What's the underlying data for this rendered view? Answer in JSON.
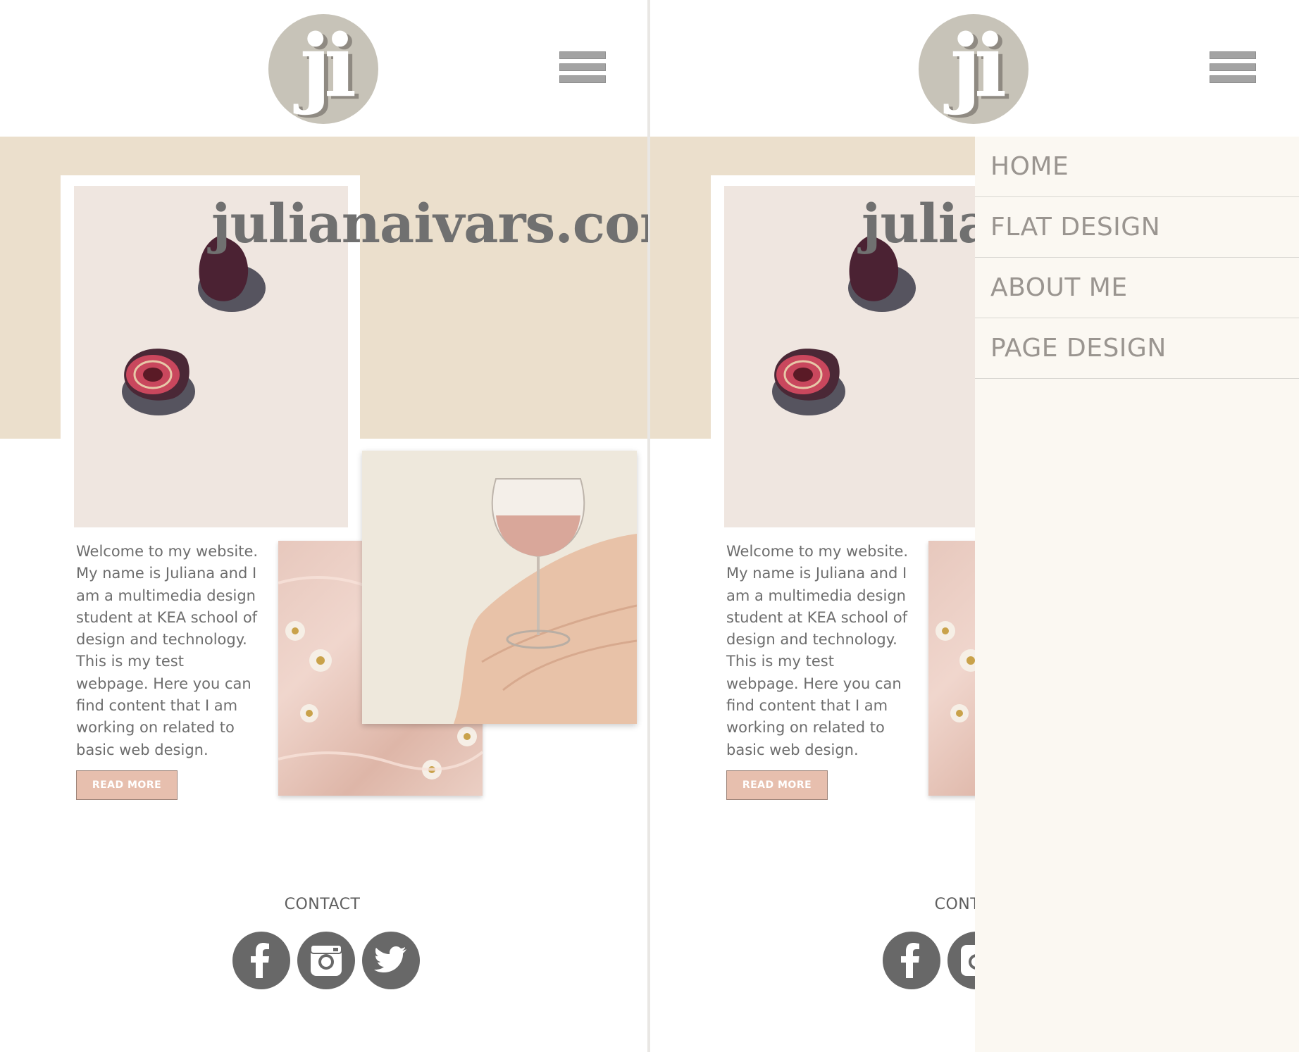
{
  "site": {
    "logo_text": "ji",
    "title": "julianaivars.com"
  },
  "intro": {
    "text": "Welcome to my website. My name is Juliana and I am a multimedia design student at KEA school of design and technology. This is my test webpage. Here you can find content that I am working on related to basic web design.",
    "button_label": "READ MORE"
  },
  "contact": {
    "label": "CONTACT",
    "icons": [
      "facebook-icon",
      "instagram-icon",
      "twitter-icon"
    ]
  },
  "menu": {
    "items": [
      {
        "label": "HOME"
      },
      {
        "label": "FLAT DESIGN"
      },
      {
        "label": "ABOUT ME"
      },
      {
        "label": "PAGE DESIGN"
      }
    ]
  },
  "colors": {
    "band": "#ebdfcc",
    "logo": "#c7c3b8",
    "button": "#e7bfae",
    "menu_background": "#fbf8f2",
    "text": "#6d6d6d",
    "social_icon": "#686868"
  }
}
